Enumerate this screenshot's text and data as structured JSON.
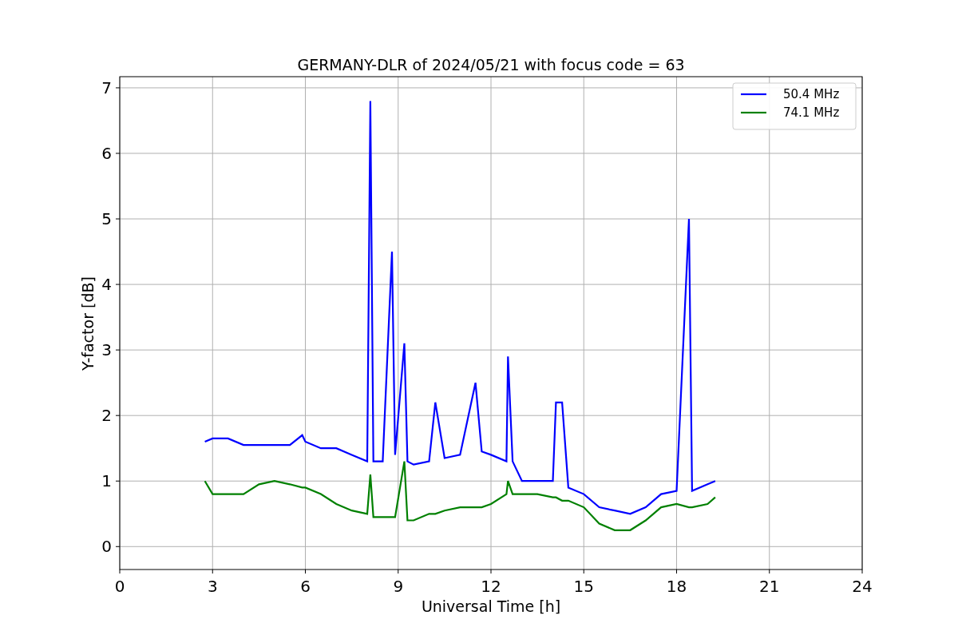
{
  "chart": {
    "chart_data": {
      "type": "line",
      "title": "GERMANY-DLR of 2024/05/21 with focus code = 63",
      "xlabel": "Universal Time [h]",
      "ylabel": "Y-factor [dB]",
      "x": [
        2.75,
        3,
        3.5,
        4,
        4.5,
        5,
        5.5,
        5.9,
        6,
        6.5,
        7,
        7.5,
        8,
        8.1,
        8.2,
        8.5,
        8.8,
        8.9,
        9.2,
        9.3,
        9.5,
        10,
        10.2,
        10.5,
        11,
        11.5,
        11.7,
        12,
        12.5,
        12.55,
        12.7,
        13,
        13.5,
        14,
        14.1,
        14.3,
        14.5,
        15,
        15.5,
        16,
        16.5,
        17,
        17.5,
        18,
        18.4,
        18.5,
        19,
        19.25
      ],
      "series": [
        {
          "name": "50.4 MHz",
          "color": "#0000ff",
          "values": [
            1.6,
            1.65,
            1.65,
            1.55,
            1.55,
            1.55,
            1.55,
            1.7,
            1.6,
            1.5,
            1.5,
            1.4,
            1.3,
            6.8,
            1.3,
            1.3,
            4.5,
            1.4,
            3.1,
            1.3,
            1.25,
            1.3,
            2.2,
            1.35,
            1.4,
            2.5,
            1.45,
            1.4,
            1.3,
            2.9,
            1.3,
            1.0,
            1.0,
            1.0,
            2.2,
            2.2,
            0.9,
            0.8,
            0.6,
            0.55,
            0.5,
            0.6,
            0.8,
            0.85,
            5.0,
            0.85,
            0.95,
            1.0
          ]
        },
        {
          "name": "74.1 MHz",
          "color": "#008000",
          "values": [
            1.0,
            0.8,
            0.8,
            0.8,
            0.95,
            1.0,
            0.95,
            0.9,
            0.9,
            0.8,
            0.65,
            0.55,
            0.5,
            1.1,
            0.45,
            0.45,
            0.45,
            0.45,
            1.3,
            0.4,
            0.4,
            0.5,
            0.5,
            0.55,
            0.6,
            0.6,
            0.6,
            0.65,
            0.8,
            1.0,
            0.8,
            0.8,
            0.8,
            0.75,
            0.75,
            0.7,
            0.7,
            0.6,
            0.35,
            0.25,
            0.25,
            0.4,
            0.6,
            0.65,
            0.6,
            0.6,
            0.65,
            0.75
          ]
        }
      ],
      "grid": true,
      "legend": true,
      "xlim": [
        0,
        24
      ],
      "ylim": [
        -0.35,
        7.17
      ],
      "xticks": [
        0,
        3,
        6,
        9,
        12,
        15,
        18,
        21,
        24
      ],
      "yticks": [
        0,
        1,
        2,
        3,
        4,
        5,
        6,
        7
      ]
    }
  }
}
